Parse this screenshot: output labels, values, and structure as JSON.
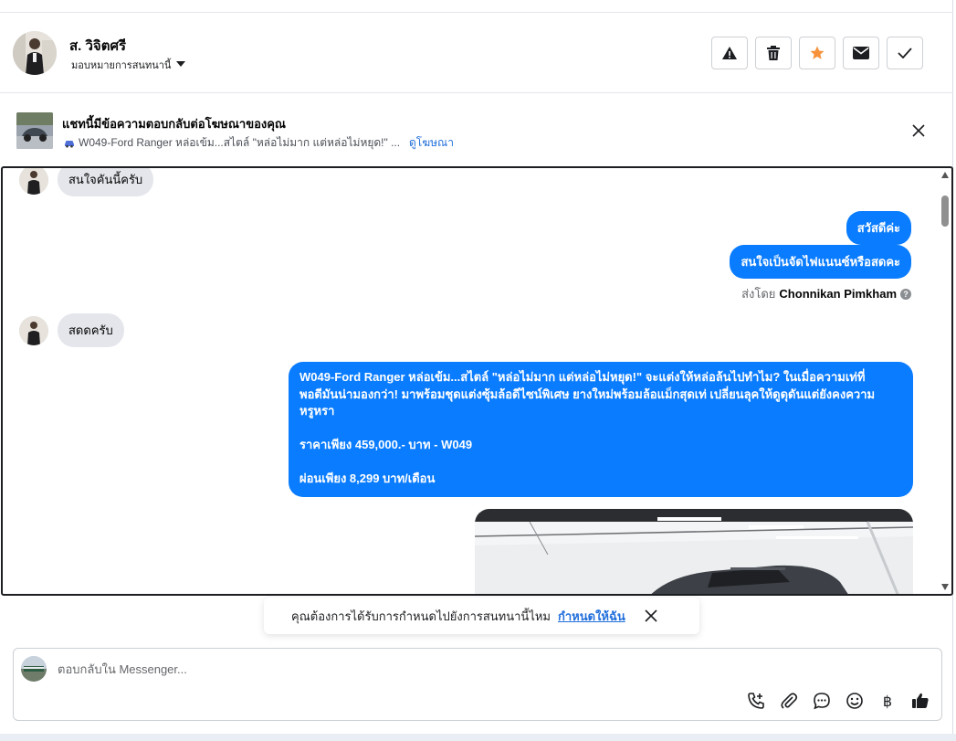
{
  "contact": {
    "name": "ส. วิจิตศรี",
    "assign_label": "มอบหมายการสนทนานี้"
  },
  "header_actions": [
    {
      "name": "spam-button",
      "icon": "warning-icon"
    },
    {
      "name": "delete-button",
      "icon": "trash-icon"
    },
    {
      "name": "star-button",
      "icon": "star-icon",
      "color": "#f7923b"
    },
    {
      "name": "mail-button",
      "icon": "envelope-icon"
    },
    {
      "name": "done-button",
      "icon": "check-icon"
    }
  ],
  "ad_banner": {
    "title": "แชทนี้มีข้อความตอบกลับต่อโฆษณาของคุณ",
    "description": "W049-Ford Ranger หล่อเข้ม...สไตล์ \"หล่อไม่มาก แต่หล่อไม่หยุด!\" ...",
    "link_label": "ดูโฆษณา"
  },
  "messages": {
    "incoming_1": "สนใจคันนี้ครับ",
    "outgoing_1": "สวัสดีค่ะ",
    "outgoing_2": "สนใจเป็นจัดไฟแนนซ์หรือสดคะ",
    "sent_by_prefix": "ส่งโดย",
    "sent_by_name": "Chonnikan Pimkham",
    "incoming_2": "สดดครับ",
    "long_message_lines": [
      "W049-Ford Ranger หล่อเข้ม...สไตล์ \"หล่อไม่มาก แต่หล่อไม่หยุด!\"  จะแต่งให้หล่อล้นไปทำไม? ในเมื่อความเท่ที่",
      "พอดีมันน่ามองกว่า! มาพร้อมชุดแต่งซุ้มล้อดีไซน์พิเศษ ยางใหม่พร้อมล้อแม็กสุดเท่ เปลี่ยนลุคให้ดูดุดันแต่ยังคงความ",
      "หรูหรา",
      "",
      " ราคาเพียง 459,000.- บาท - W049",
      "",
      " ผ่อนเพียง 8,299 บาท/เดือน"
    ]
  },
  "assign_prompt": {
    "text": "คุณต้องการได้รับการกำหนดไปยังการสนทนานี้ไหม",
    "link": "กำหนดให้ฉัน"
  },
  "composer": {
    "placeholder": "ตอบกลับใน Messenger...",
    "value": ""
  },
  "composer_tools": [
    "phone-plus-icon",
    "paperclip-icon",
    "chat-bubble-icon",
    "emoji-icon",
    "baht-icon",
    "thumbs-up-icon"
  ],
  "colors": {
    "brand_blue": "#0a7cff",
    "link_blue": "#216fdb",
    "star_orange": "#f7923b"
  }
}
